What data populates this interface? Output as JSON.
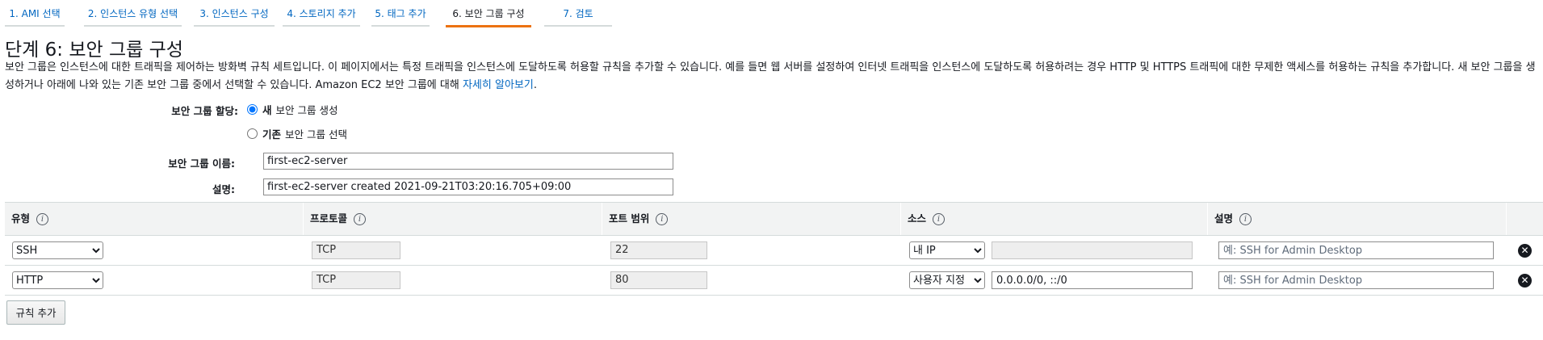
{
  "tabs": [
    {
      "label": "1. AMI 선택"
    },
    {
      "label": "2. 인스턴스 유형 선택"
    },
    {
      "label": "3. 인스턴스 구성"
    },
    {
      "label": "4. 스토리지 추가"
    },
    {
      "label": "5. 태그 추가"
    },
    {
      "label": "6. 보안 그룹 구성"
    },
    {
      "label": "7. 검토"
    }
  ],
  "active_tab": "6. 보안 그룹 구성",
  "page": {
    "title": "단계 6: 보안 그룹 구성",
    "description": "보안 그룹은 인스턴스에 대한 트래픽을 제어하는 방화벽 규칙 세트입니다. 이 페이지에서는 특정 트래픽을 인스턴스에 도달하도록 허용할 규칙을 추가할 수 있습니다. 예를 들면 웹 서버를 설정하여 인터넷 트래픽을 인스턴스에 도달하도록 허용하려는 경우 HTTP 및 HTTPS 트래픽에 대한 무제한 액세스를 허용하는 규칙을 추가합니다. 새 보안 그룹을 생성하거나 아래에 나와 있는 기존 보안 그룹 중에서 선택할 수 있습니다. Amazon EC2 보안 그룹에 대해",
    "learn_more": "자세히 알아보기",
    "period": "."
  },
  "form": {
    "assign_label": "보안 그룹 할당:",
    "option_new_bold": "새",
    "option_new_rest": "보안 그룹 생성",
    "option_existing_bold": "기존",
    "option_existing_rest": "보안 그룹 선택",
    "selected_option": "new",
    "name_label": "보안 그룹 이름:",
    "name_value": "first-ec2-server",
    "desc_label": "설명:",
    "desc_value": "first-ec2-server created 2021-09-21T03:20:16.705+09:00"
  },
  "table": {
    "headers": [
      "유형",
      "프로토콜",
      "포트 범위",
      "소스",
      "설명"
    ],
    "info_icon": "i",
    "rows": [
      {
        "type": "SSH",
        "protocol": "TCP",
        "port": "22",
        "source_type": "내 IP",
        "source_value": "",
        "description": "",
        "description_placeholder": "예: SSH for Admin Desktop"
      },
      {
        "type": "HTTP",
        "protocol": "TCP",
        "port": "80",
        "source_type": "사용자 지정",
        "source_value": "0.0.0.0/0, ::/0",
        "description": "",
        "description_placeholder": "예: SSH for Admin Desktop"
      }
    ],
    "delete_icon": "✕",
    "add_rule_label": "규칙 추가"
  }
}
